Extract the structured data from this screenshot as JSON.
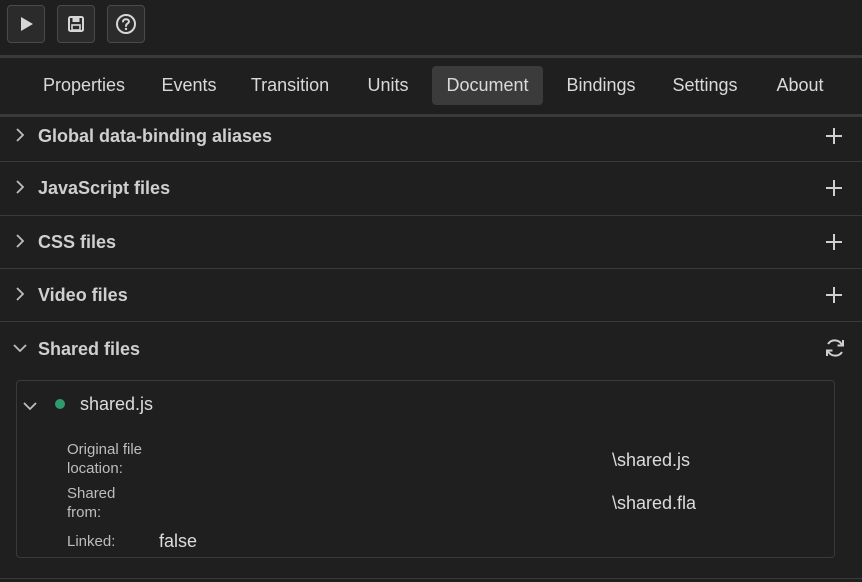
{
  "toolbar": {
    "buttons": [
      {
        "icon": "play-icon"
      },
      {
        "icon": "save-icon"
      },
      {
        "icon": "help-icon"
      }
    ]
  },
  "tabs": [
    {
      "label": "Properties"
    },
    {
      "label": "Events"
    },
    {
      "label": "Transition"
    },
    {
      "label": "Units"
    },
    {
      "label": "Document",
      "active": true
    },
    {
      "label": "Bindings"
    },
    {
      "label": "Settings"
    },
    {
      "label": "About"
    }
  ],
  "sections": [
    {
      "title": "Global data-binding aliases",
      "expanded": false,
      "action_icon": "plus-icon"
    },
    {
      "title": "JavaScript files",
      "expanded": false,
      "action_icon": "plus-icon"
    },
    {
      "title": "CSS files",
      "expanded": false,
      "action_icon": "plus-icon"
    },
    {
      "title": "Video files",
      "expanded": false,
      "action_icon": "plus-icon"
    },
    {
      "title": "Shared files",
      "expanded": true,
      "action_icon": "refresh-icon"
    }
  ],
  "shared_file": {
    "name": "shared.js",
    "status_color": "#2e9a6e",
    "original_location_label_line1": "Original file",
    "original_location_label_line2": "location:",
    "original_location_value": "\\shared.js",
    "shared_from_label_line1": "Shared",
    "shared_from_label_line2": "from:",
    "shared_from_value": "\\shared.fla",
    "linked_label": "Linked:",
    "linked_value": "false"
  },
  "colors": {
    "background": "#1f1f1f",
    "active_tab": "#3b3b3b",
    "separator": "#3a3a3a",
    "status_dot": "#2e9a6e"
  }
}
